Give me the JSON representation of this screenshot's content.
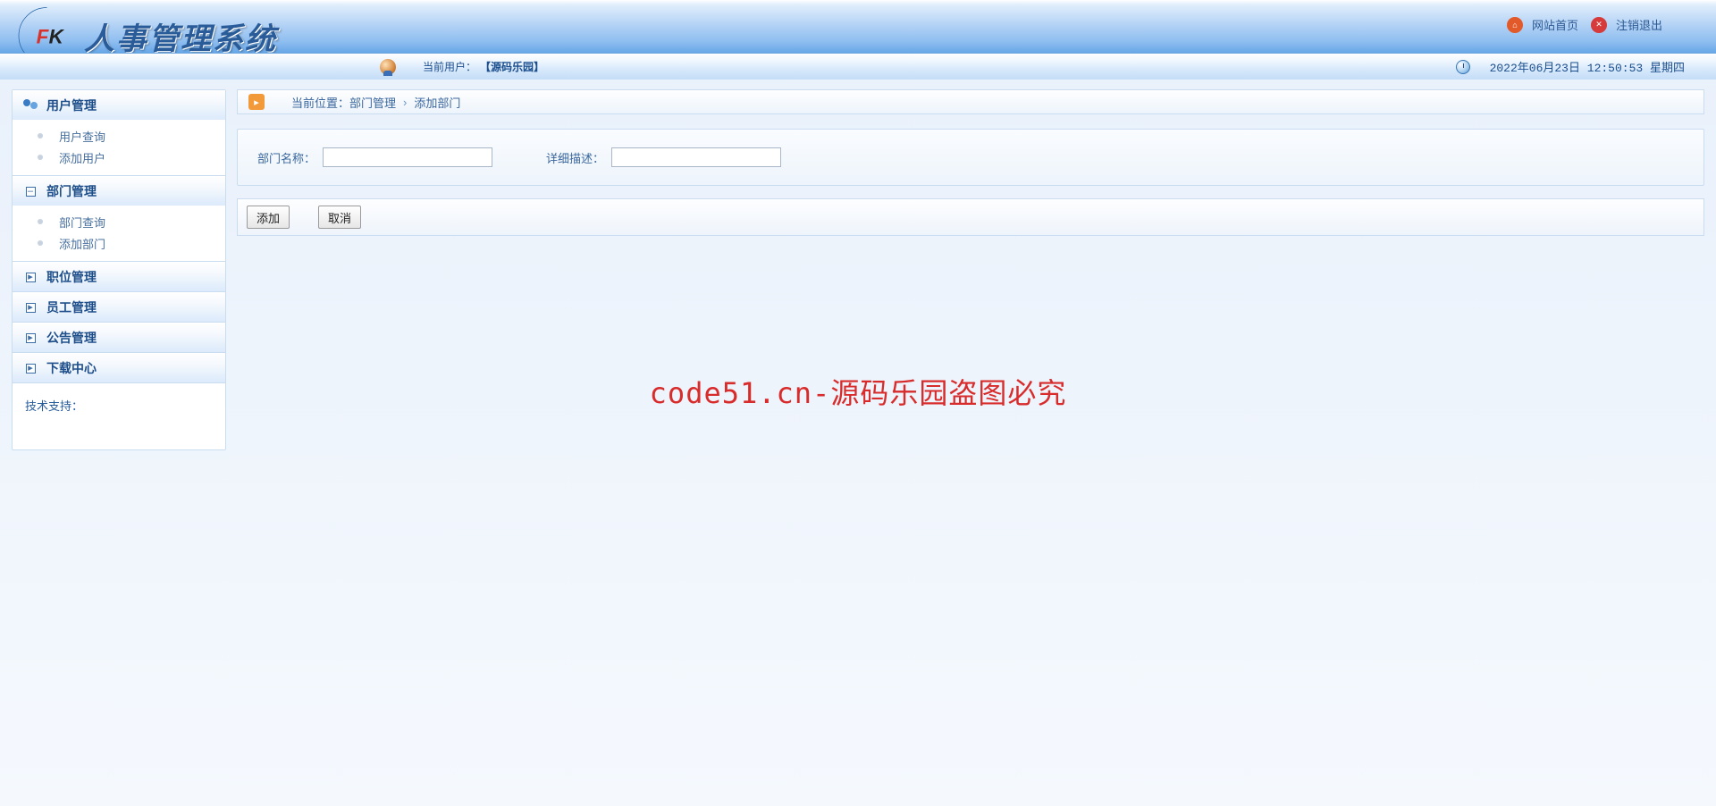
{
  "header": {
    "logo_fk": "FK",
    "logo_text": "人事管理系统",
    "links": {
      "home": "网站首页",
      "logout": "注销退出"
    },
    "cur_user_label": "当前用户：",
    "cur_user_name": "【源码乐园】",
    "datetime": "2022年06月23日 12:50:53 星期四"
  },
  "sidebar": {
    "sections": [
      {
        "label": "用户管理",
        "icon": "users",
        "open": true,
        "items": [
          {
            "label": "用户查询"
          },
          {
            "label": "添加用户"
          }
        ]
      },
      {
        "label": "部门管理",
        "icon": "toggle",
        "open": true,
        "items": [
          {
            "label": "部门查询"
          },
          {
            "label": "添加部门"
          }
        ]
      },
      {
        "label": "职位管理",
        "icon": "toggle",
        "open": false
      },
      {
        "label": "员工管理",
        "icon": "toggle",
        "open": false
      },
      {
        "label": "公告管理",
        "icon": "toggle",
        "open": false
      },
      {
        "label": "下载中心",
        "icon": "toggle",
        "open": false
      }
    ],
    "footer": "技术支持："
  },
  "crumb": {
    "prefix": "当前位置：",
    "a": "部门管理",
    "b": "添加部门"
  },
  "form": {
    "name_label": "部门名称：",
    "desc_label": "详细描述：",
    "add_btn": "添加",
    "cancel_btn": "取消"
  },
  "watermark": "code51.cn-源码乐园盗图必究"
}
